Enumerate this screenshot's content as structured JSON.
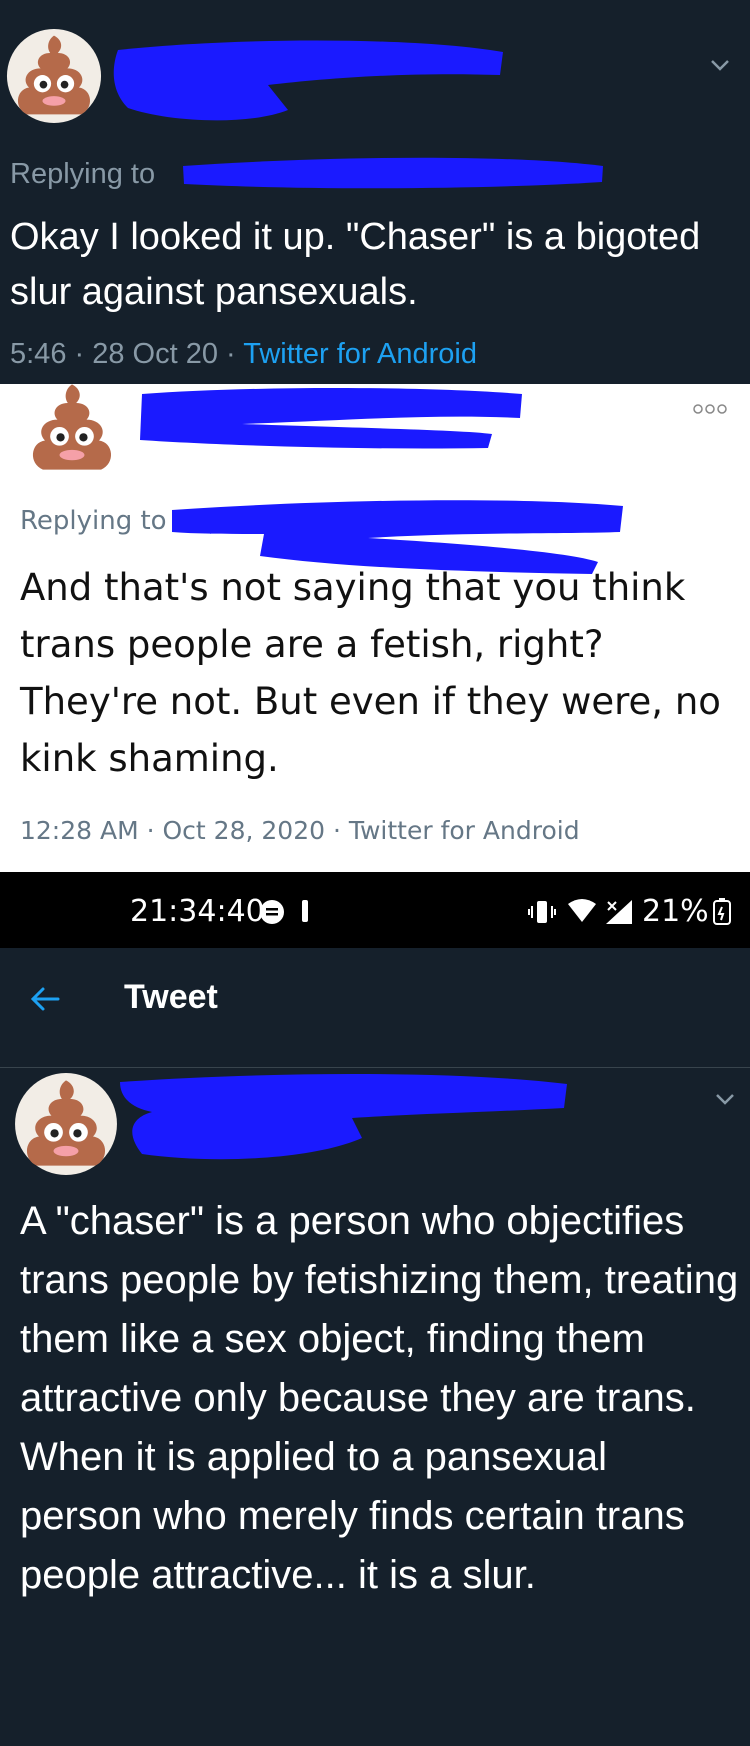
{
  "tweet1": {
    "replying_prefix": "Replying to",
    "text": "Okay I looked it up. \"Chaser\" is a bigoted slur against pansexuals.",
    "time": "5:46",
    "date": "28 Oct 20",
    "client": "Twitter for Android",
    "separator": " · "
  },
  "tweet2": {
    "replying_prefix": "Replying to",
    "text": "And that's not saying that you think trans people are a fetish, right? They're not. But even if they were, no kink shaming.",
    "timestamp": "12:28 AM · Oct 28, 2020 · Twitter for Android"
  },
  "status_bar": {
    "time": "21:34:40",
    "battery": "21%"
  },
  "app_bar": {
    "title": "Tweet"
  },
  "tweet3": {
    "text": "A \"chaser\" is a person who objectifies trans people by fetishizing them, treating them like a sex object, finding them attractive only because they are trans. When it is applied to a pansexual person who merely finds certain trans people attractive... it is a slur."
  },
  "colors": {
    "dark_bg": "#15202b",
    "link": "#1da1f2",
    "redaction": "#1a1aff",
    "avatar": "#b56a4a"
  },
  "icons": [
    "poop-avatar-icon",
    "chevron-down-icon",
    "more-icon",
    "back-arrow-icon",
    "message-icon",
    "vibrate-icon",
    "wifi-icon",
    "signal-icon",
    "battery-icon"
  ]
}
